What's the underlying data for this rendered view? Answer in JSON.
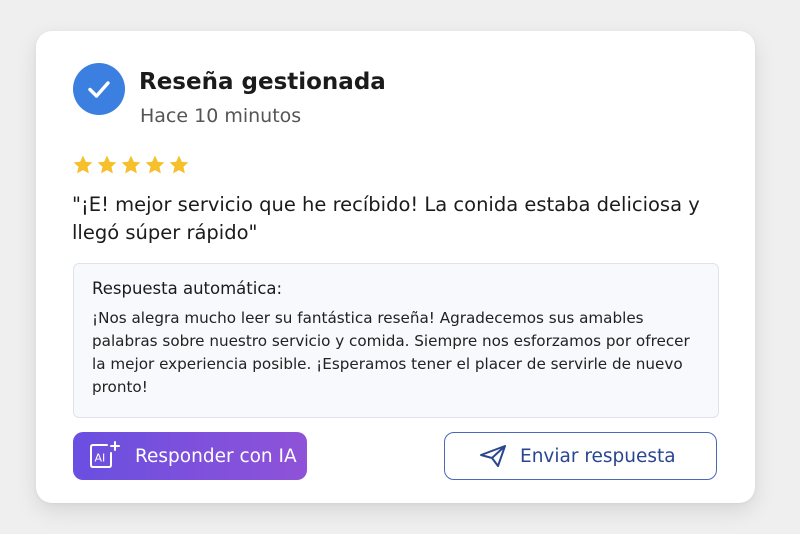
{
  "header": {
    "title": "Reseña gestionada",
    "time": "Hace 10 minutos",
    "status_icon": "check-circle-icon"
  },
  "review": {
    "rating": 5,
    "max_rating": 5,
    "star_color": "#f6c02d",
    "text": "\"¡E! mejor servicio que he recíbido! La conida estaba deliciosa y llegó súper rápido\""
  },
  "response": {
    "label": "Respuesta automática:",
    "text": "¡Nos alegra mucho leer su fantástica reseña! Agradecemos sus amables palabras sobre nuestro servicio y comida. Siempre nos esforzamos por ofrecer la mejor experiencia posible. ¡Esperamos tener el placer de servirle de nuevo pronto!"
  },
  "actions": {
    "ai_button_label": "Responder con IA",
    "ai_button_icon": "ai-sparkle-icon",
    "ai_button_icon_text": "AI",
    "send_button_label": "Enviar respuesta",
    "send_button_icon": "send-icon"
  },
  "colors": {
    "accent_blue": "#3b80e0",
    "ai_gradient_start": "#6a4fe0",
    "ai_gradient_end": "#8f52d8",
    "send_border": "#4a67b8"
  }
}
